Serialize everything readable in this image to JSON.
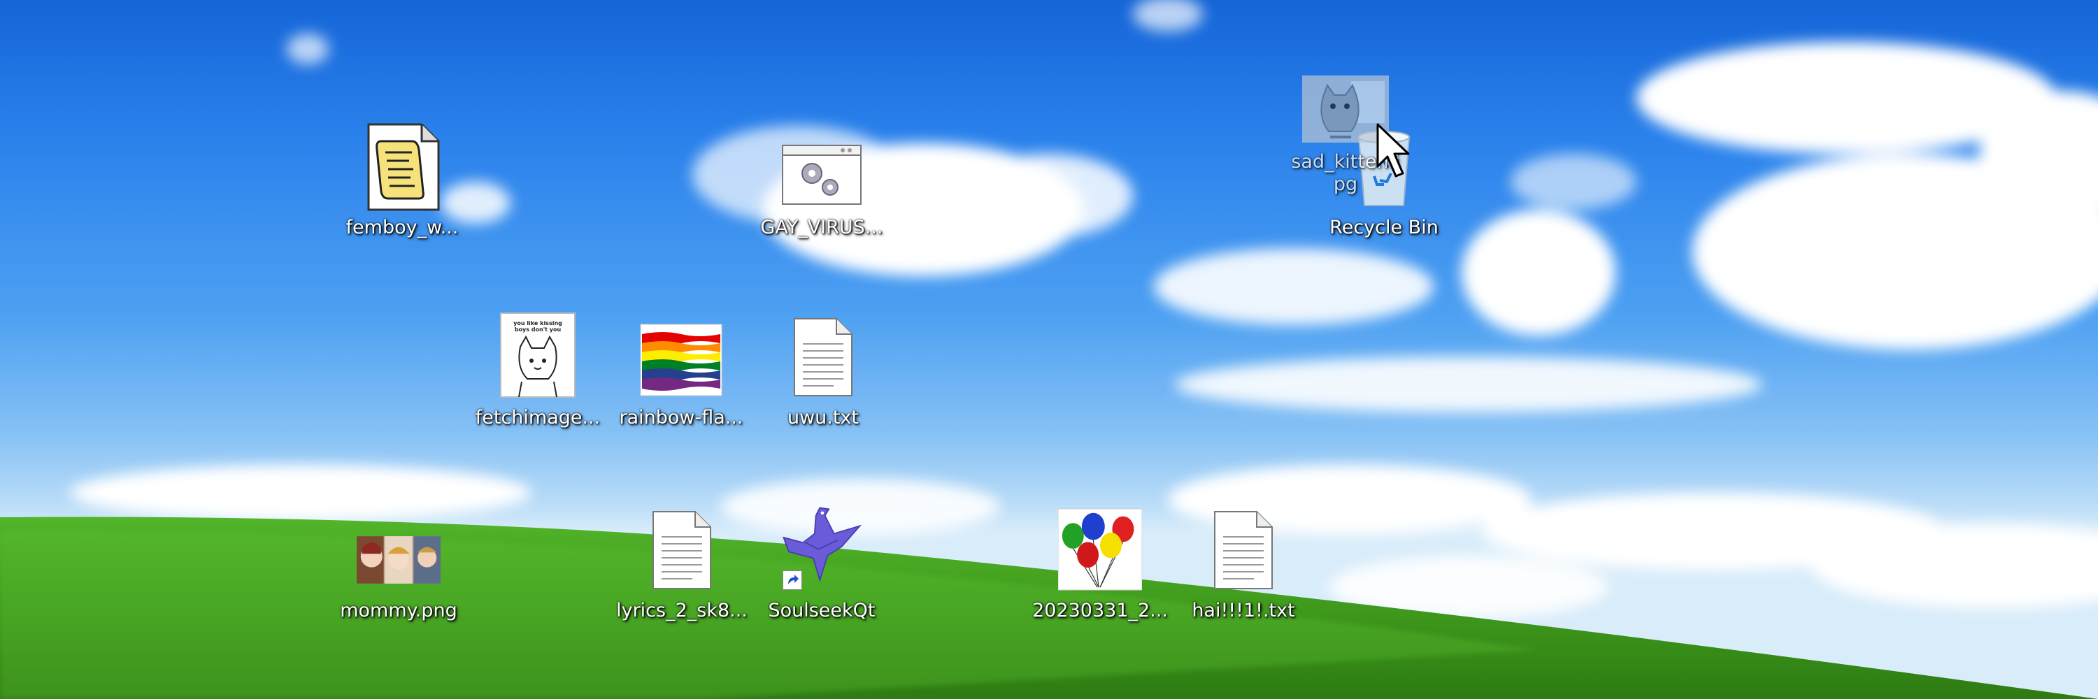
{
  "desktop": {
    "icons": [
      {
        "label": "femboy_w...",
        "icon": "script-icon"
      },
      {
        "label": "GAY_VIRUS...",
        "icon": "settings-app-icon"
      },
      {
        "label": "fetchimage...",
        "icon": "image-thumbnail-icon"
      },
      {
        "label": "rainbow-fla...",
        "icon": "rainbow-flag-icon"
      },
      {
        "label": "uwu.txt",
        "icon": "text-file-icon"
      },
      {
        "label": "mommy.png",
        "icon": "image-thumbnail-icon"
      },
      {
        "label": "lyrics_2_sk8...",
        "icon": "text-file-icon"
      },
      {
        "label": "SoulseekQt",
        "icon": "soulseek-bird-icon"
      },
      {
        "label": "20230331_2...",
        "icon": "balloons-image-icon"
      },
      {
        "label": "hai!!!1!.txt",
        "icon": "text-file-icon"
      },
      {
        "label": "Recycle Bin",
        "icon": "recycle-bin-icon"
      }
    ],
    "dragged": {
      "label": "sad_kitten.jpg",
      "icon": "kitten-image-icon"
    },
    "thumbnail_text": "you like kissing boys don't you",
    "colors": {
      "sky_top": "#1565d8",
      "sky_bottom": "#d8ecfa",
      "grass": "#3f9a1c",
      "label_text": "#ffffff"
    }
  }
}
